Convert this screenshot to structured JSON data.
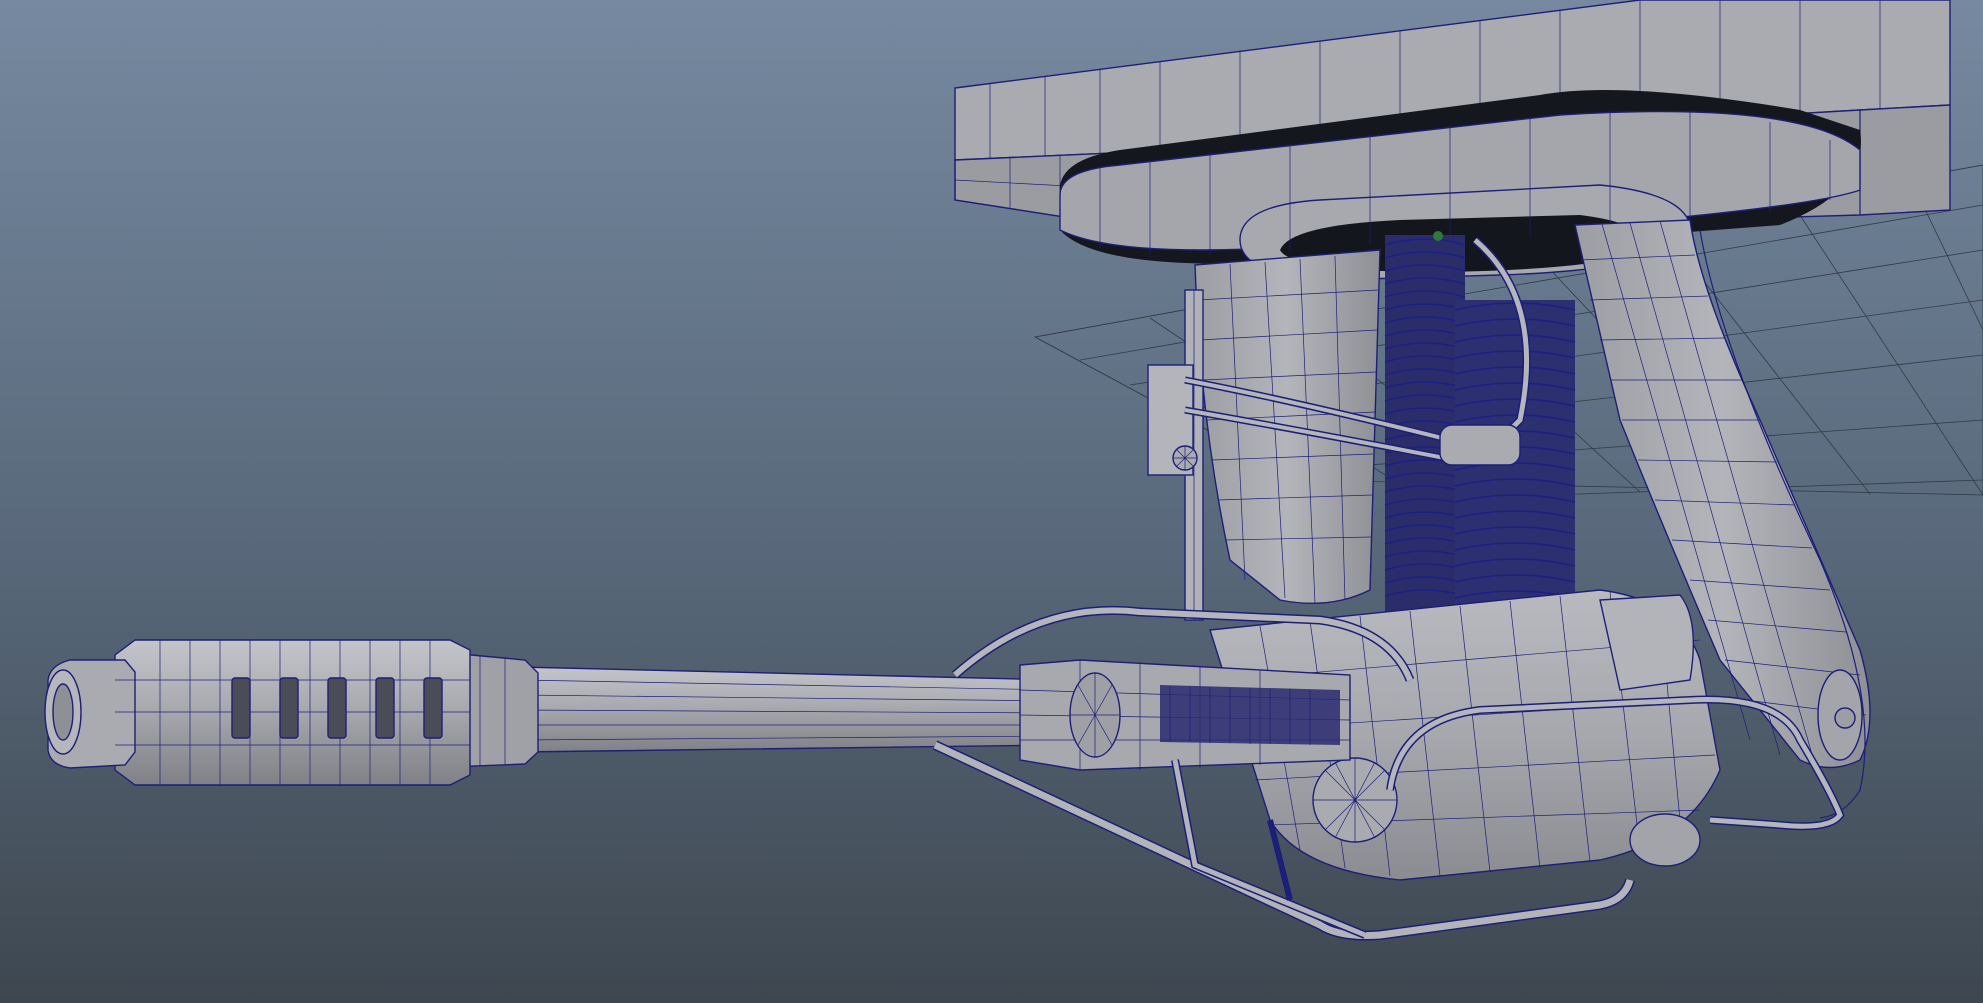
{
  "viewport": {
    "panel": "perspective",
    "display_mode": "wireframe-on-shaded",
    "colors": {
      "background_top": "#7689a0",
      "background_bottom": "#3e4750",
      "mesh_fill": "#a9abb1",
      "mesh_shade": "#8c8e94",
      "mesh_dark": "#1c1e2a",
      "wire": "#1c1f78",
      "ground_grid": "#2e3c48"
    }
  },
  "scene": {
    "model": "turret-gun-mount",
    "parts": [
      "mounting-plate",
      "rotation-ring",
      "support-arm-left",
      "support-arm-right",
      "shock-absorber-coils",
      "gun-barrel",
      "muzzle-brake",
      "receiver-body",
      "hydraulic-hoses",
      "underside-brace"
    ],
    "ground_grid_visible": true
  }
}
